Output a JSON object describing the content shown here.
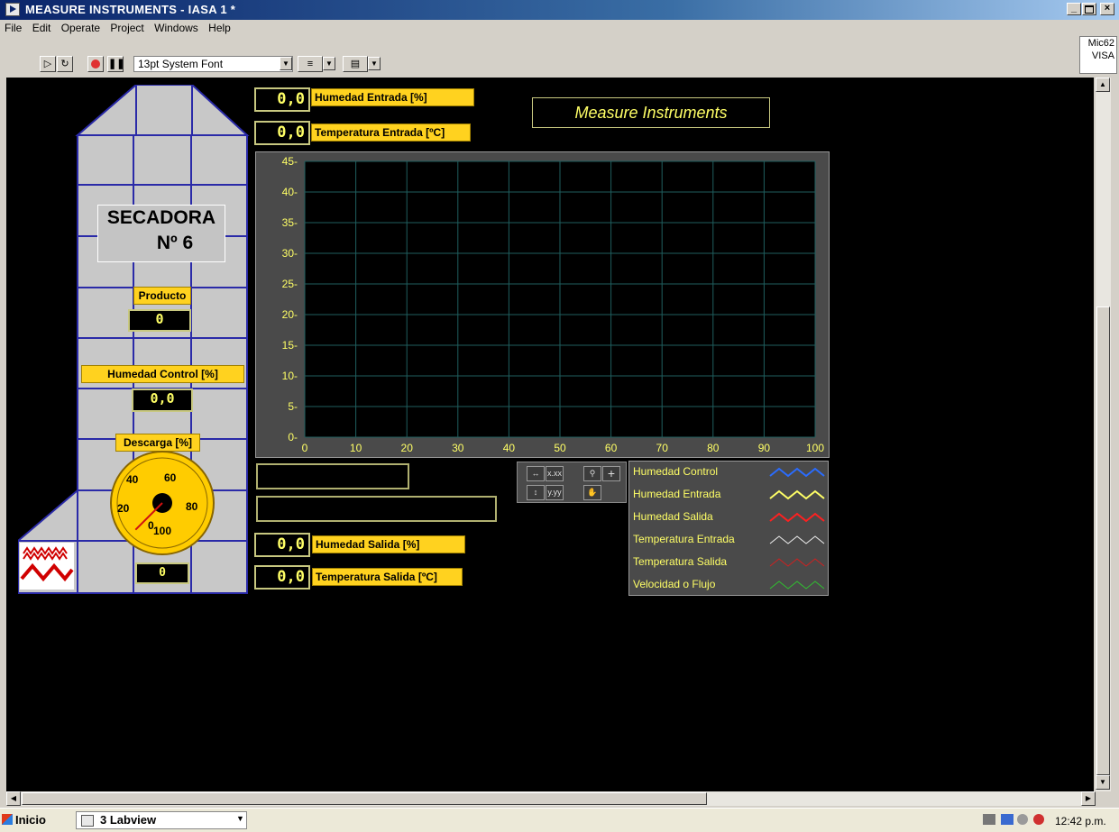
{
  "window": {
    "title": "MEASURE INSTRUMENTS - IASA 1 *",
    "minimize": "_",
    "maximize": " ",
    "close": "×"
  },
  "menu": [
    "File",
    "Edit",
    "Operate",
    "Project",
    "Windows",
    "Help"
  ],
  "toolbar": {
    "font": "13pt System Font"
  },
  "side_label": [
    "Mic62",
    "VISA"
  ],
  "panel": {
    "title": "Measure Instruments",
    "humedad_entrada": {
      "value": "0,0",
      "label": "Humedad Entrada [%]"
    },
    "temperatura_entrada": {
      "value": "0,0",
      "label": "Temperatura Entrada [ºC]"
    },
    "humedad_salida": {
      "value": "0,0",
      "label": "Humedad Salida [%]"
    },
    "temperatura_salida": {
      "value": "0,0",
      "label": "Temperatura Salida [ºC]"
    },
    "dryer": {
      "name_line1": "SECADORA",
      "name_line2": "Nº 6",
      "producto_label": "Producto",
      "producto_value": "0",
      "humedad_control_label": "Humedad Control [%]",
      "humedad_control_value": "0,0",
      "descarga_label": "Descarga [%]",
      "descarga_value": "0",
      "gauge_ticks": [
        "0",
        "20",
        "40",
        "60",
        "80",
        "100"
      ],
      "gauge_value": 0
    }
  },
  "chart_data": {
    "type": "line",
    "x_ticks": [
      "0",
      "10",
      "20",
      "30",
      "40",
      "50",
      "60",
      "70",
      "80",
      "90",
      "100"
    ],
    "y_ticks": [
      "0",
      "5",
      "10",
      "15",
      "20",
      "25",
      "30",
      "35",
      "40",
      "45"
    ],
    "xlim": [
      0,
      100
    ],
    "ylim": [
      0,
      45
    ],
    "grid": true,
    "series": [
      {
        "name": "Humedad Control",
        "color": "#2a6cff",
        "values": []
      },
      {
        "name": "Humedad Entrada",
        "color": "#ffff66",
        "values": []
      },
      {
        "name": "Humedad Salida",
        "color": "#ff2020",
        "values": []
      },
      {
        "name": "Temperatura Entrada",
        "color": "#f0f0f0",
        "values": []
      },
      {
        "name": "Temperatura Salida",
        "color": "#d02020",
        "values": []
      },
      {
        "name": "Velocidad o Flujo",
        "color": "#30c030",
        "values": []
      }
    ]
  },
  "taskbar": {
    "start": "Inicio",
    "task": "3 Labview",
    "clock": "12:42 p.m."
  }
}
